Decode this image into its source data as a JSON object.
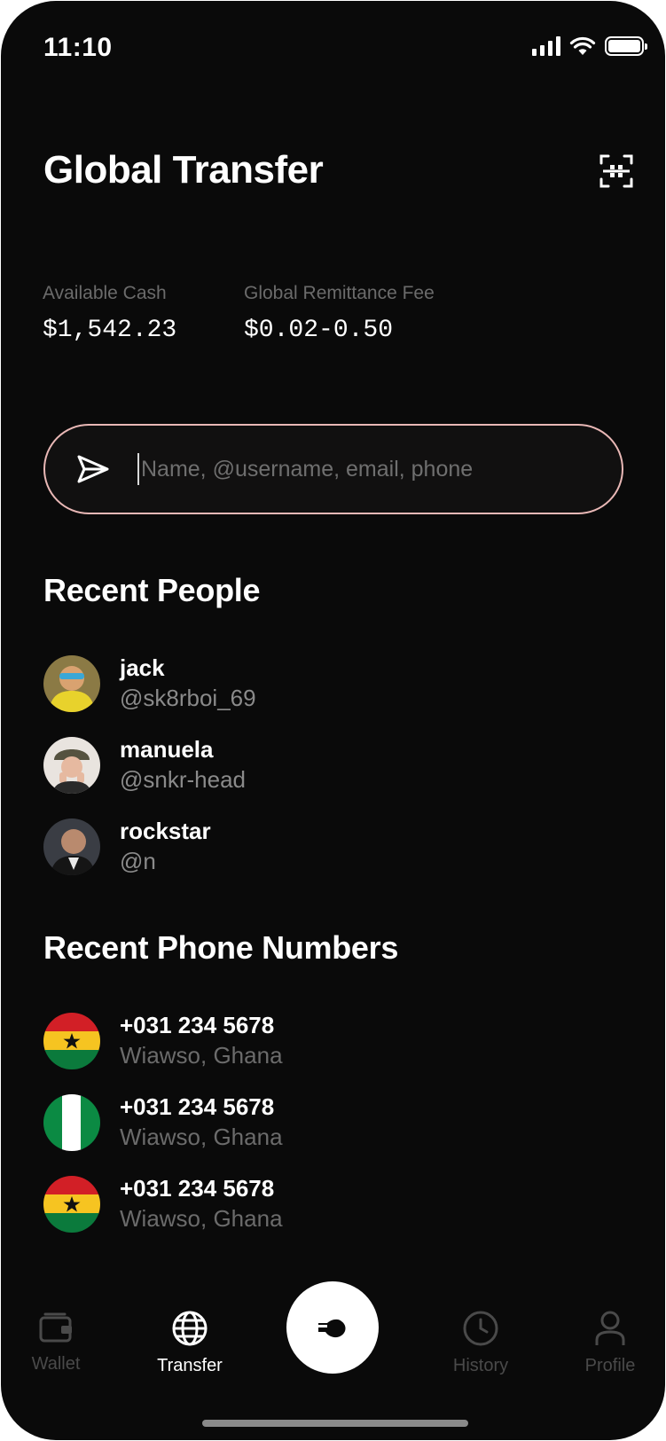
{
  "status_bar": {
    "time": "11:10"
  },
  "header": {
    "title": "Global Transfer",
    "scan_icon": "qr-scan-icon"
  },
  "stats": {
    "available_label": "Available Cash",
    "available_value": "$1,542.23",
    "fee_label": "Global Remittance Fee",
    "fee_value": "$0.02-0.50"
  },
  "search": {
    "placeholder": "Name, @username, email, phone",
    "value": ""
  },
  "recent_people": {
    "title": "Recent People",
    "items": [
      {
        "name": "jack",
        "handle": "@sk8rboi_69"
      },
      {
        "name": "manuela",
        "handle": "@snkr-head"
      },
      {
        "name": "rockstar",
        "handle": "@n"
      }
    ]
  },
  "recent_phones": {
    "title": "Recent Phone Numbers",
    "items": [
      {
        "number": "+031 234 5678",
        "location": "Wiawso, Ghana",
        "flag": "ghana-flag"
      },
      {
        "number": "+031 234 5678",
        "location": "Wiawso, Ghana",
        "flag": "nigeria-flag"
      },
      {
        "number": "+031 234 5678",
        "location": "Wiawso, Ghana",
        "flag": "ghana-flag"
      }
    ]
  },
  "tabbar": {
    "wallet": "Wallet",
    "transfer": "Transfer",
    "history": "History",
    "profile": "Profile",
    "active": "Transfer"
  },
  "colors": {
    "background": "#0a0a0a",
    "search_border": "#e9b8b6",
    "muted_text": "#8a8a8a"
  }
}
